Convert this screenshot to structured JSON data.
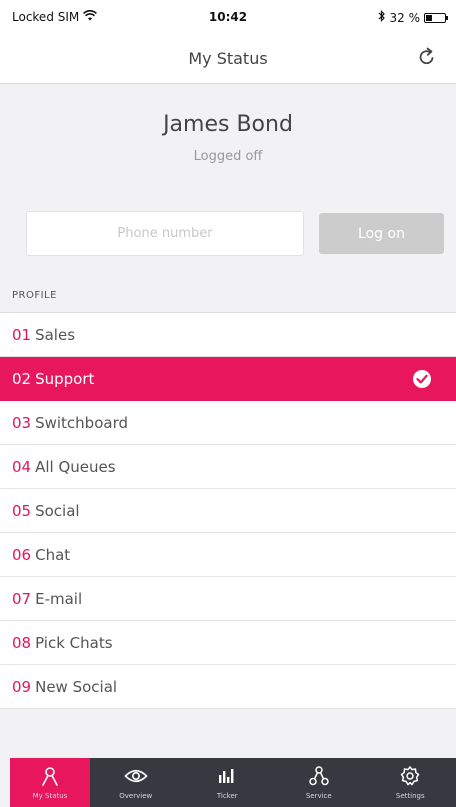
{
  "status_bar": {
    "carrier": "Locked SIM",
    "time": "10:42",
    "battery_text": "32 %",
    "battery_level": 0.32
  },
  "nav": {
    "title": "My Status"
  },
  "user": {
    "name": "James Bond",
    "status": "Logged off"
  },
  "logon": {
    "phone_placeholder": "Phone number",
    "phone_value": "",
    "button_label": "Log on"
  },
  "profile": {
    "header": "PROFILE",
    "items": [
      {
        "num": "01",
        "label": "Sales",
        "selected": false
      },
      {
        "num": "02",
        "label": "Support",
        "selected": true
      },
      {
        "num": "03",
        "label": "Switchboard",
        "selected": false
      },
      {
        "num": "04",
        "label": "All Queues",
        "selected": false
      },
      {
        "num": "05",
        "label": "Social",
        "selected": false
      },
      {
        "num": "06",
        "label": "Chat",
        "selected": false
      },
      {
        "num": "07",
        "label": "E-mail",
        "selected": false
      },
      {
        "num": "08",
        "label": "Pick Chats",
        "selected": false
      },
      {
        "num": "09",
        "label": "New Social",
        "selected": false
      }
    ]
  },
  "tabs": [
    {
      "label": "My Status",
      "icon": "person-icon",
      "active": true
    },
    {
      "label": "Overview",
      "icon": "eye-icon",
      "active": false
    },
    {
      "label": "Ticker",
      "icon": "bar-chart-icon",
      "active": false
    },
    {
      "label": "Service",
      "icon": "network-icon",
      "active": false
    },
    {
      "label": "Settings",
      "icon": "gear-icon",
      "active": false
    }
  ],
  "colors": {
    "accent": "#e8175d",
    "tabbar": "#383841",
    "button_disabled": "#cccccc"
  }
}
